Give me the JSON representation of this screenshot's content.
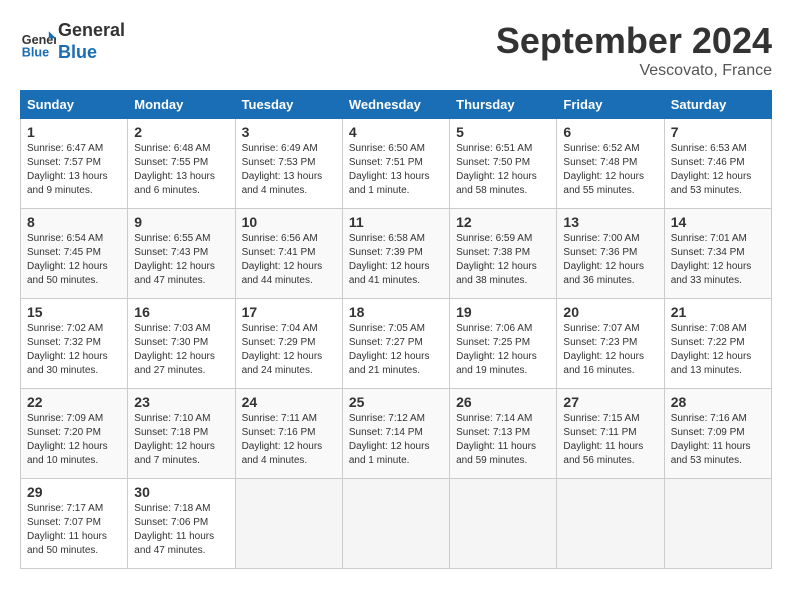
{
  "header": {
    "logo_line1": "General",
    "logo_line2": "Blue",
    "month_title": "September 2024",
    "location": "Vescovato, France"
  },
  "days_of_week": [
    "Sunday",
    "Monday",
    "Tuesday",
    "Wednesday",
    "Thursday",
    "Friday",
    "Saturday"
  ],
  "weeks": [
    [
      {
        "day": "1",
        "sunrise": "Sunrise: 6:47 AM",
        "sunset": "Sunset: 7:57 PM",
        "daylight": "Daylight: 13 hours and 9 minutes."
      },
      {
        "day": "2",
        "sunrise": "Sunrise: 6:48 AM",
        "sunset": "Sunset: 7:55 PM",
        "daylight": "Daylight: 13 hours and 6 minutes."
      },
      {
        "day": "3",
        "sunrise": "Sunrise: 6:49 AM",
        "sunset": "Sunset: 7:53 PM",
        "daylight": "Daylight: 13 hours and 4 minutes."
      },
      {
        "day": "4",
        "sunrise": "Sunrise: 6:50 AM",
        "sunset": "Sunset: 7:51 PM",
        "daylight": "Daylight: 13 hours and 1 minute."
      },
      {
        "day": "5",
        "sunrise": "Sunrise: 6:51 AM",
        "sunset": "Sunset: 7:50 PM",
        "daylight": "Daylight: 12 hours and 58 minutes."
      },
      {
        "day": "6",
        "sunrise": "Sunrise: 6:52 AM",
        "sunset": "Sunset: 7:48 PM",
        "daylight": "Daylight: 12 hours and 55 minutes."
      },
      {
        "day": "7",
        "sunrise": "Sunrise: 6:53 AM",
        "sunset": "Sunset: 7:46 PM",
        "daylight": "Daylight: 12 hours and 53 minutes."
      }
    ],
    [
      {
        "day": "8",
        "sunrise": "Sunrise: 6:54 AM",
        "sunset": "Sunset: 7:45 PM",
        "daylight": "Daylight: 12 hours and 50 minutes."
      },
      {
        "day": "9",
        "sunrise": "Sunrise: 6:55 AM",
        "sunset": "Sunset: 7:43 PM",
        "daylight": "Daylight: 12 hours and 47 minutes."
      },
      {
        "day": "10",
        "sunrise": "Sunrise: 6:56 AM",
        "sunset": "Sunset: 7:41 PM",
        "daylight": "Daylight: 12 hours and 44 minutes."
      },
      {
        "day": "11",
        "sunrise": "Sunrise: 6:58 AM",
        "sunset": "Sunset: 7:39 PM",
        "daylight": "Daylight: 12 hours and 41 minutes."
      },
      {
        "day": "12",
        "sunrise": "Sunrise: 6:59 AM",
        "sunset": "Sunset: 7:38 PM",
        "daylight": "Daylight: 12 hours and 38 minutes."
      },
      {
        "day": "13",
        "sunrise": "Sunrise: 7:00 AM",
        "sunset": "Sunset: 7:36 PM",
        "daylight": "Daylight: 12 hours and 36 minutes."
      },
      {
        "day": "14",
        "sunrise": "Sunrise: 7:01 AM",
        "sunset": "Sunset: 7:34 PM",
        "daylight": "Daylight: 12 hours and 33 minutes."
      }
    ],
    [
      {
        "day": "15",
        "sunrise": "Sunrise: 7:02 AM",
        "sunset": "Sunset: 7:32 PM",
        "daylight": "Daylight: 12 hours and 30 minutes."
      },
      {
        "day": "16",
        "sunrise": "Sunrise: 7:03 AM",
        "sunset": "Sunset: 7:30 PM",
        "daylight": "Daylight: 12 hours and 27 minutes."
      },
      {
        "day": "17",
        "sunrise": "Sunrise: 7:04 AM",
        "sunset": "Sunset: 7:29 PM",
        "daylight": "Daylight: 12 hours and 24 minutes."
      },
      {
        "day": "18",
        "sunrise": "Sunrise: 7:05 AM",
        "sunset": "Sunset: 7:27 PM",
        "daylight": "Daylight: 12 hours and 21 minutes."
      },
      {
        "day": "19",
        "sunrise": "Sunrise: 7:06 AM",
        "sunset": "Sunset: 7:25 PM",
        "daylight": "Daylight: 12 hours and 19 minutes."
      },
      {
        "day": "20",
        "sunrise": "Sunrise: 7:07 AM",
        "sunset": "Sunset: 7:23 PM",
        "daylight": "Daylight: 12 hours and 16 minutes."
      },
      {
        "day": "21",
        "sunrise": "Sunrise: 7:08 AM",
        "sunset": "Sunset: 7:22 PM",
        "daylight": "Daylight: 12 hours and 13 minutes."
      }
    ],
    [
      {
        "day": "22",
        "sunrise": "Sunrise: 7:09 AM",
        "sunset": "Sunset: 7:20 PM",
        "daylight": "Daylight: 12 hours and 10 minutes."
      },
      {
        "day": "23",
        "sunrise": "Sunrise: 7:10 AM",
        "sunset": "Sunset: 7:18 PM",
        "daylight": "Daylight: 12 hours and 7 minutes."
      },
      {
        "day": "24",
        "sunrise": "Sunrise: 7:11 AM",
        "sunset": "Sunset: 7:16 PM",
        "daylight": "Daylight: 12 hours and 4 minutes."
      },
      {
        "day": "25",
        "sunrise": "Sunrise: 7:12 AM",
        "sunset": "Sunset: 7:14 PM",
        "daylight": "Daylight: 12 hours and 1 minute."
      },
      {
        "day": "26",
        "sunrise": "Sunrise: 7:14 AM",
        "sunset": "Sunset: 7:13 PM",
        "daylight": "Daylight: 11 hours and 59 minutes."
      },
      {
        "day": "27",
        "sunrise": "Sunrise: 7:15 AM",
        "sunset": "Sunset: 7:11 PM",
        "daylight": "Daylight: 11 hours and 56 minutes."
      },
      {
        "day": "28",
        "sunrise": "Sunrise: 7:16 AM",
        "sunset": "Sunset: 7:09 PM",
        "daylight": "Daylight: 11 hours and 53 minutes."
      }
    ],
    [
      {
        "day": "29",
        "sunrise": "Sunrise: 7:17 AM",
        "sunset": "Sunset: 7:07 PM",
        "daylight": "Daylight: 11 hours and 50 minutes."
      },
      {
        "day": "30",
        "sunrise": "Sunrise: 7:18 AM",
        "sunset": "Sunset: 7:06 PM",
        "daylight": "Daylight: 11 hours and 47 minutes."
      },
      null,
      null,
      null,
      null,
      null
    ]
  ]
}
